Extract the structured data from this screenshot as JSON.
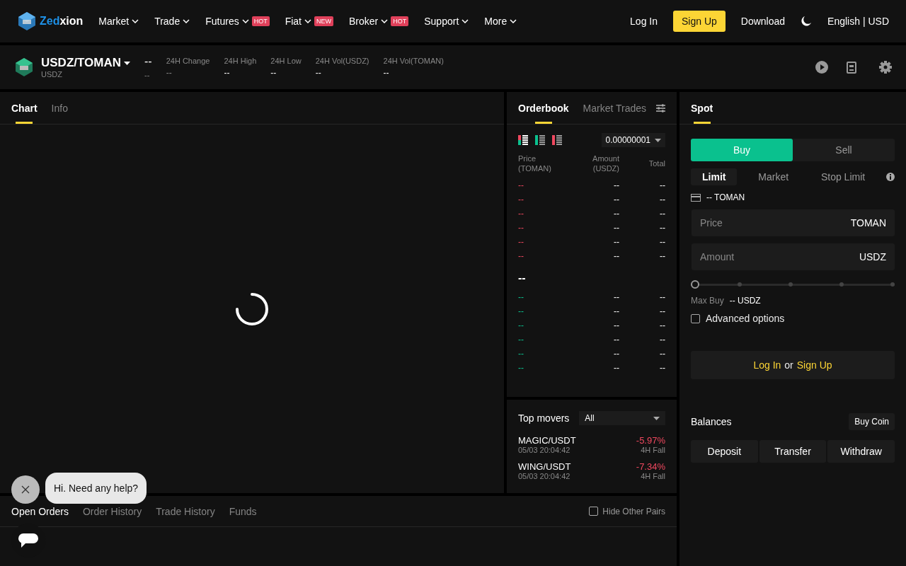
{
  "nav": {
    "logo": [
      "Zed",
      "xion"
    ],
    "items": [
      {
        "label": "Market"
      },
      {
        "label": "Trade"
      },
      {
        "label": "Futures",
        "badge": "HOT"
      },
      {
        "label": "Fiat",
        "badge": "NEW"
      },
      {
        "label": "Broker",
        "badge": "HOT"
      },
      {
        "label": "Support"
      },
      {
        "label": "More"
      }
    ],
    "login": "Log In",
    "signup": "Sign Up",
    "download": "Download",
    "locale": "English | USD"
  },
  "ticker": {
    "pair": "USDZ/TOMAN",
    "base": "USDZ",
    "price": "--",
    "price_sub": "--",
    "stats": [
      {
        "label": "24H Change",
        "value": "--"
      },
      {
        "label": "24H High",
        "value": "--"
      },
      {
        "label": "24H Low",
        "value": "--"
      },
      {
        "label": "24H Vol(USDZ)",
        "value": "--"
      },
      {
        "label": "24H Vol(TOMAN)",
        "value": "--"
      }
    ]
  },
  "chart_panel": {
    "tabs": [
      {
        "label": "Chart",
        "selected": true
      },
      {
        "label": "Info",
        "selected": false
      }
    ]
  },
  "orderbook": {
    "tabs": [
      {
        "label": "Orderbook",
        "selected": true
      },
      {
        "label": "Market Trades",
        "selected": false
      }
    ],
    "precision": "0.00000001",
    "columns": [
      "Price (TOMAN)",
      "Amount (USDZ)",
      "Total"
    ],
    "asks": [
      [
        "--",
        "--",
        "--"
      ],
      [
        "--",
        "--",
        "--"
      ],
      [
        "--",
        "--",
        "--"
      ],
      [
        "--",
        "--",
        "--"
      ],
      [
        "--",
        "--",
        "--"
      ],
      [
        "--",
        "--",
        "--"
      ]
    ],
    "last_price": "--",
    "bids": [
      [
        "--",
        "--",
        "--"
      ],
      [
        "--",
        "--",
        "--"
      ],
      [
        "--",
        "--",
        "--"
      ],
      [
        "--",
        "--",
        "--"
      ],
      [
        "--",
        "--",
        "--"
      ],
      [
        "--",
        "--",
        "--"
      ]
    ]
  },
  "top_movers": {
    "title": "Top movers",
    "filter": "All",
    "items": [
      {
        "pair": "MAGIC/USDT",
        "time": "05/03 20:04:42",
        "change": "-5.97%",
        "label": "4H Fall"
      },
      {
        "pair": "WING/USDT",
        "time": "05/03 20:04:42",
        "change": "-7.34%",
        "label": "4H Fall"
      }
    ]
  },
  "spot": {
    "tabs": [
      {
        "label": "Spot",
        "selected": true
      }
    ],
    "sides": [
      {
        "label": "Buy",
        "selected": true
      },
      {
        "label": "Sell",
        "selected": false
      }
    ],
    "order_types": [
      {
        "label": "Limit",
        "selected": true
      },
      {
        "label": "Market",
        "selected": false
      },
      {
        "label": "Stop Limit",
        "selected": false
      }
    ],
    "available": "-- TOMAN",
    "fields": [
      {
        "placeholder": "Price",
        "unit": "TOMAN"
      },
      {
        "placeholder": "Amount",
        "unit": "USDZ"
      }
    ],
    "slider": {
      "level": 0
    },
    "max_label": "Max Buy",
    "max_value": "-- USDZ",
    "advanced": {
      "label": "Advanced options",
      "checked": false
    },
    "auth": {
      "login": "Log In",
      "or": "or",
      "signup": "Sign Up"
    },
    "balances": {
      "title": "Balances",
      "buy_coin": "Buy Coin",
      "actions": [
        "Deposit",
        "Transfer",
        "Withdraw"
      ]
    }
  },
  "orders": {
    "tabs": [
      {
        "label": "Open Orders",
        "selected": true
      },
      {
        "label": "Order History",
        "selected": false
      },
      {
        "label": "Trade History",
        "selected": false
      },
      {
        "label": "Funds",
        "selected": false
      }
    ],
    "hide_other": {
      "label": "Hide Other Pairs",
      "checked": false
    }
  },
  "chat": {
    "message": "Hi. Need any help?"
  }
}
